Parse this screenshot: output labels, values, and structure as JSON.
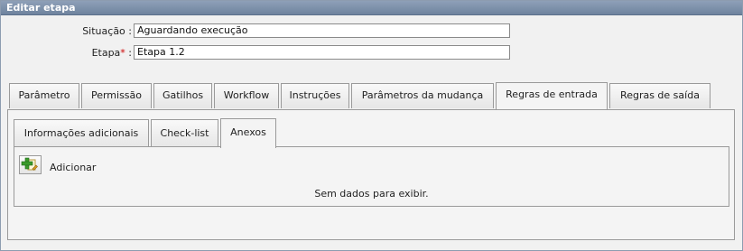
{
  "panel": {
    "title": "Editar etapa"
  },
  "form": {
    "situacao": {
      "label": "Situação :",
      "value": "Aguardando execução"
    },
    "etapa": {
      "label": "Etapa",
      "required_mark": "*",
      "colon": " :",
      "value": "Etapa 1.2"
    }
  },
  "tabs": [
    {
      "label": "Parâmetro"
    },
    {
      "label": "Permissão"
    },
    {
      "label": "Gatilhos"
    },
    {
      "label": "Workflow"
    },
    {
      "label": "Instruções"
    },
    {
      "label": "Parâmetros da mudança"
    },
    {
      "label": "Regras de entrada",
      "active": true
    },
    {
      "label": "Regras de saída"
    }
  ],
  "subtabs": [
    {
      "label": "Informações adicionais"
    },
    {
      "label": "Check-list"
    },
    {
      "label": "Anexos",
      "active": true
    }
  ],
  "toolbar": {
    "add_label": "Adicionar",
    "add_icon": "add-attachment-icon"
  },
  "grid": {
    "empty_message": "Sem dados para exibir."
  },
  "colors": {
    "header": "#7b8da6",
    "required": "#cc0000",
    "add_icon_green": "#3a9a2a"
  }
}
